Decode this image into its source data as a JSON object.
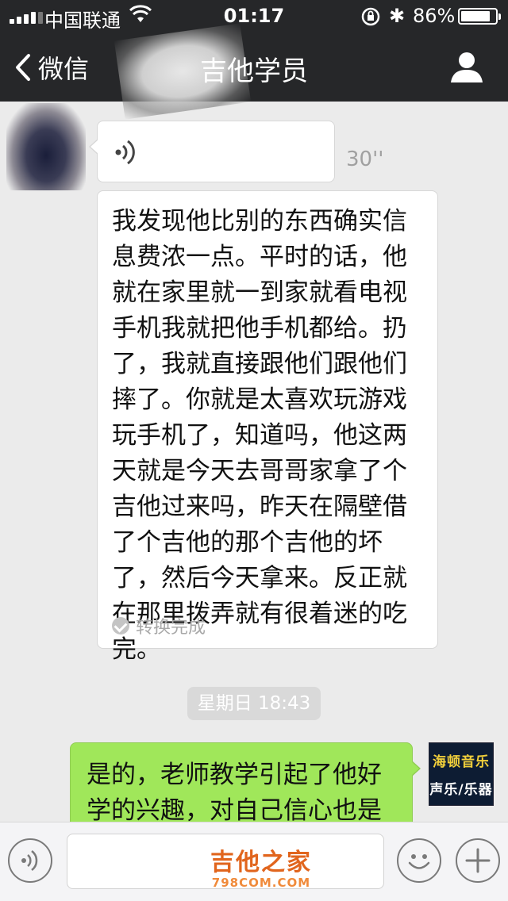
{
  "status_bar": {
    "carrier": "中国联通",
    "time": "01:17",
    "battery_percent_label": "86%",
    "battery_level": 0.86
  },
  "nav": {
    "back_label": "微信",
    "title": "吉他学员"
  },
  "messages": {
    "voice": {
      "duration": "30''"
    },
    "transcript": {
      "text": "我发现他比别的东西确实信息费浓一点。平时的话，他就在家里就一到家就看电视手机我就把他手机都给。扔了，我就直接跟他们跟他们摔了。你就是太喜欢玩游戏玩手机了，知道吗，他这两天就是今天去哥哥家拿了个吉他过来吗，昨天在隔壁借了个吉他的那个吉他的坏了，然后今天拿来。反正就在那里拨弄就有很着迷的吃完。",
      "status": "转换完成"
    },
    "timestamp": "星期日 18:43",
    "reply": {
      "text": "是的，老师教学引起了他好学的兴趣，对自己信心也是"
    },
    "my_avatar": {
      "line1": "海顿音乐",
      "line2": "声乐/乐器"
    }
  },
  "watermark": {
    "main": "吉他之家",
    "sub": "798COM.COM"
  },
  "colors": {
    "nav_bg": "#262729",
    "chat_bg": "#ebebeb",
    "my_bubble": "#a0e75a",
    "watermark": "#e1651d"
  }
}
